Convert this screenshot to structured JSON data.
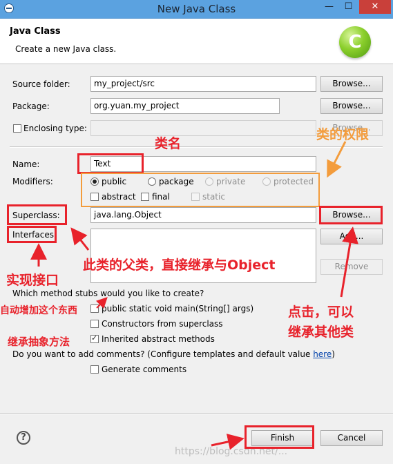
{
  "window": {
    "title": "New Java Class",
    "minimize": "—",
    "maximize": "☐",
    "close": "✕"
  },
  "header": {
    "title": "Java Class",
    "description": "Create a new Java class.",
    "logo_letter": "C"
  },
  "form": {
    "source_folder": {
      "label": "Source folder:",
      "value": "my_project/src",
      "button": "Browse..."
    },
    "package": {
      "label": "Package:",
      "value": "org.yuan.my_project",
      "button": "Browse..."
    },
    "enclosing_type": {
      "label": "Enclosing type:",
      "value": "",
      "button": "Browse..."
    },
    "name": {
      "label": "Name:",
      "value": "Text"
    },
    "modifiers": {
      "label": "Modifiers:",
      "public": "public",
      "package": "package",
      "private": "private",
      "protected": "protected",
      "abstract": "abstract",
      "final": "final",
      "static": "static"
    },
    "superclass": {
      "label": "Superclass:",
      "value": "java.lang.Object",
      "button": "Browse..."
    },
    "interfaces": {
      "label": "Interfaces:",
      "add_button": "Add...",
      "remove_button": "Remove"
    },
    "stubs": {
      "question": "Which method stubs would you like to create?",
      "main": "public static void main(String[] args)",
      "constructors": "Constructors from superclass",
      "inherited": "Inherited abstract methods"
    },
    "comments": {
      "question_prefix": "Do you want to add comments? (Configure templates and default value ",
      "link": "here",
      "question_suffix": ")",
      "generate": "Generate comments"
    }
  },
  "footer": {
    "help": "?",
    "finish": "Finish",
    "cancel": "Cancel"
  },
  "annotations": {
    "class_name": "类名",
    "class_permission": "类的权限",
    "parent_class": "此类的父类，直接继承与Object",
    "implement_interface": "实现接口",
    "auto_add": "自动增加这个东西",
    "inherit_abstract": "继承抽象方法",
    "click_inherit_line1": "点击，可以",
    "click_inherit_line2": "继承其他类"
  },
  "watermark": "https://blog.csdn.net/...",
  "colors": {
    "annotation_red": "#e8222b",
    "annotation_orange": "#f39c3c",
    "titlebar": "#5ba2e0"
  }
}
